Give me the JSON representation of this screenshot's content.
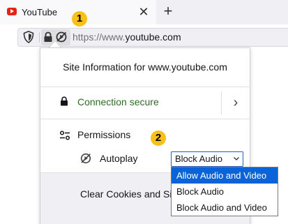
{
  "tab": {
    "title": "YouTube",
    "favicon": "youtube-icon",
    "close_icon": "close-icon",
    "close_glyph": "✕",
    "new_tab_icon": "plus-icon",
    "new_tab_glyph": "+"
  },
  "urlbar": {
    "tracking_icon": "shield-icon",
    "site_icon": "lock-icon",
    "autoplay_icon": "autoplay-blocked-icon",
    "url_prefix": "https://www.",
    "url_host": "youtube.com"
  },
  "callouts": [
    "1",
    "2"
  ],
  "panel": {
    "title": "Site Information for www.youtube.com",
    "connection": {
      "label": "Connection secure",
      "icon": "lock-icon",
      "expand_icon": "chevron-right-icon",
      "expand_glyph": "›"
    },
    "permissions": {
      "label": "Permissions",
      "icon": "sliders-icon"
    },
    "autoplay": {
      "label": "Autoplay",
      "icon": "autoplay-blocked-icon",
      "selected": "Block Audio",
      "options": [
        "Allow Audio and Video",
        "Block Audio",
        "Block Audio and Video"
      ],
      "highlighted_option": "Allow Audio and Video"
    },
    "footer": {
      "clear_label": "Clear Cookies and Site Data"
    }
  },
  "colors": {
    "connection_secure": "#2f6b26",
    "highlight": "#0a64d8",
    "badge": "#f8c019",
    "favicon": "#e62117"
  }
}
